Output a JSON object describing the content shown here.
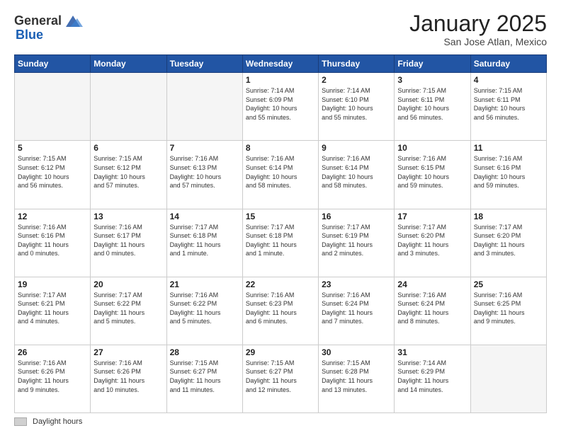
{
  "logo": {
    "general": "General",
    "blue": "Blue"
  },
  "title": "January 2025",
  "location": "San Jose Atlan, Mexico",
  "days_header": [
    "Sunday",
    "Monday",
    "Tuesday",
    "Wednesday",
    "Thursday",
    "Friday",
    "Saturday"
  ],
  "footer_label": "Daylight hours",
  "weeks": [
    [
      {
        "day": "",
        "info": ""
      },
      {
        "day": "",
        "info": ""
      },
      {
        "day": "",
        "info": ""
      },
      {
        "day": "1",
        "info": "Sunrise: 7:14 AM\nSunset: 6:09 PM\nDaylight: 10 hours\nand 55 minutes."
      },
      {
        "day": "2",
        "info": "Sunrise: 7:14 AM\nSunset: 6:10 PM\nDaylight: 10 hours\nand 55 minutes."
      },
      {
        "day": "3",
        "info": "Sunrise: 7:15 AM\nSunset: 6:11 PM\nDaylight: 10 hours\nand 56 minutes."
      },
      {
        "day": "4",
        "info": "Sunrise: 7:15 AM\nSunset: 6:11 PM\nDaylight: 10 hours\nand 56 minutes."
      }
    ],
    [
      {
        "day": "5",
        "info": "Sunrise: 7:15 AM\nSunset: 6:12 PM\nDaylight: 10 hours\nand 56 minutes."
      },
      {
        "day": "6",
        "info": "Sunrise: 7:15 AM\nSunset: 6:12 PM\nDaylight: 10 hours\nand 57 minutes."
      },
      {
        "day": "7",
        "info": "Sunrise: 7:16 AM\nSunset: 6:13 PM\nDaylight: 10 hours\nand 57 minutes."
      },
      {
        "day": "8",
        "info": "Sunrise: 7:16 AM\nSunset: 6:14 PM\nDaylight: 10 hours\nand 58 minutes."
      },
      {
        "day": "9",
        "info": "Sunrise: 7:16 AM\nSunset: 6:14 PM\nDaylight: 10 hours\nand 58 minutes."
      },
      {
        "day": "10",
        "info": "Sunrise: 7:16 AM\nSunset: 6:15 PM\nDaylight: 10 hours\nand 59 minutes."
      },
      {
        "day": "11",
        "info": "Sunrise: 7:16 AM\nSunset: 6:16 PM\nDaylight: 10 hours\nand 59 minutes."
      }
    ],
    [
      {
        "day": "12",
        "info": "Sunrise: 7:16 AM\nSunset: 6:16 PM\nDaylight: 11 hours\nand 0 minutes."
      },
      {
        "day": "13",
        "info": "Sunrise: 7:16 AM\nSunset: 6:17 PM\nDaylight: 11 hours\nand 0 minutes."
      },
      {
        "day": "14",
        "info": "Sunrise: 7:17 AM\nSunset: 6:18 PM\nDaylight: 11 hours\nand 1 minute."
      },
      {
        "day": "15",
        "info": "Sunrise: 7:17 AM\nSunset: 6:18 PM\nDaylight: 11 hours\nand 1 minute."
      },
      {
        "day": "16",
        "info": "Sunrise: 7:17 AM\nSunset: 6:19 PM\nDaylight: 11 hours\nand 2 minutes."
      },
      {
        "day": "17",
        "info": "Sunrise: 7:17 AM\nSunset: 6:20 PM\nDaylight: 11 hours\nand 3 minutes."
      },
      {
        "day": "18",
        "info": "Sunrise: 7:17 AM\nSunset: 6:20 PM\nDaylight: 11 hours\nand 3 minutes."
      }
    ],
    [
      {
        "day": "19",
        "info": "Sunrise: 7:17 AM\nSunset: 6:21 PM\nDaylight: 11 hours\nand 4 minutes."
      },
      {
        "day": "20",
        "info": "Sunrise: 7:17 AM\nSunset: 6:22 PM\nDaylight: 11 hours\nand 5 minutes."
      },
      {
        "day": "21",
        "info": "Sunrise: 7:16 AM\nSunset: 6:22 PM\nDaylight: 11 hours\nand 5 minutes."
      },
      {
        "day": "22",
        "info": "Sunrise: 7:16 AM\nSunset: 6:23 PM\nDaylight: 11 hours\nand 6 minutes."
      },
      {
        "day": "23",
        "info": "Sunrise: 7:16 AM\nSunset: 6:24 PM\nDaylight: 11 hours\nand 7 minutes."
      },
      {
        "day": "24",
        "info": "Sunrise: 7:16 AM\nSunset: 6:24 PM\nDaylight: 11 hours\nand 8 minutes."
      },
      {
        "day": "25",
        "info": "Sunrise: 7:16 AM\nSunset: 6:25 PM\nDaylight: 11 hours\nand 9 minutes."
      }
    ],
    [
      {
        "day": "26",
        "info": "Sunrise: 7:16 AM\nSunset: 6:26 PM\nDaylight: 11 hours\nand 9 minutes."
      },
      {
        "day": "27",
        "info": "Sunrise: 7:16 AM\nSunset: 6:26 PM\nDaylight: 11 hours\nand 10 minutes."
      },
      {
        "day": "28",
        "info": "Sunrise: 7:15 AM\nSunset: 6:27 PM\nDaylight: 11 hours\nand 11 minutes."
      },
      {
        "day": "29",
        "info": "Sunrise: 7:15 AM\nSunset: 6:27 PM\nDaylight: 11 hours\nand 12 minutes."
      },
      {
        "day": "30",
        "info": "Sunrise: 7:15 AM\nSunset: 6:28 PM\nDaylight: 11 hours\nand 13 minutes."
      },
      {
        "day": "31",
        "info": "Sunrise: 7:14 AM\nSunset: 6:29 PM\nDaylight: 11 hours\nand 14 minutes."
      },
      {
        "day": "",
        "info": ""
      }
    ]
  ]
}
